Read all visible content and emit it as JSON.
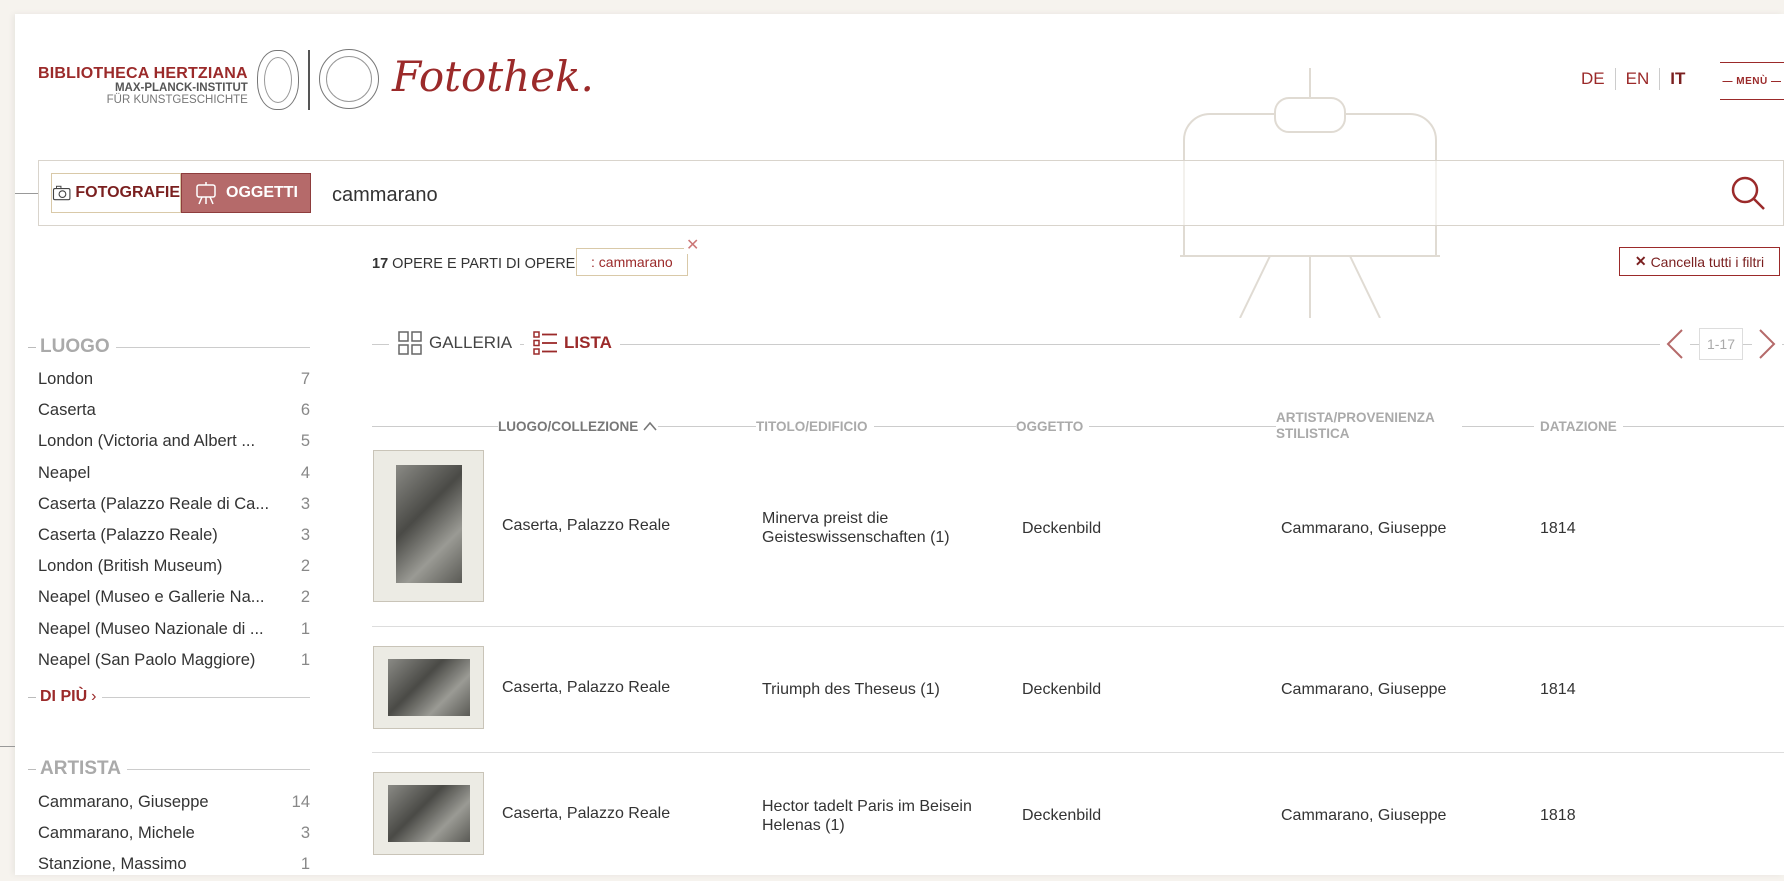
{
  "header": {
    "institute_line1": "BIBLIOTHECA HERTZIANA",
    "institute_line2": "MAX-PLANCK-INSTITUT",
    "institute_line3": "FÜR KUNSTGESCHICHTE",
    "site_title": "Fotothek.",
    "languages": [
      "DE",
      "EN",
      "IT"
    ],
    "active_language": "IT",
    "menu_label": "— MENÙ —"
  },
  "search": {
    "tab_photos": "FOTOGRAFIE",
    "tab_objects": "OGGETTI",
    "query": "cammarano"
  },
  "results": {
    "count": "17",
    "count_label": "OPERE E PARTI DI OPERE",
    "filter_chip": ": cammarano",
    "clear_all": "Cancella tutti i filtri",
    "view_gallery": "GALLERIA",
    "view_list": "LISTA",
    "page_range": "1-17"
  },
  "facets": {
    "luogo": {
      "title": "LUOGO",
      "items": [
        {
          "label": "London",
          "count": "7"
        },
        {
          "label": "Caserta",
          "count": "6"
        },
        {
          "label": "London (Victoria and Albert ...",
          "count": "5"
        },
        {
          "label": "Neapel",
          "count": "4"
        },
        {
          "label": "Caserta (Palazzo Reale di Ca...",
          "count": "3"
        },
        {
          "label": "Caserta (Palazzo Reale)",
          "count": "3"
        },
        {
          "label": "London (British Museum)",
          "count": "2"
        },
        {
          "label": "Neapel (Museo e Gallerie Na...",
          "count": "2"
        },
        {
          "label": "Neapel (Museo Nazionale di ...",
          "count": "1"
        },
        {
          "label": "Neapel (San Paolo Maggiore)",
          "count": "1"
        }
      ],
      "more": "DI PIÙ"
    },
    "artista": {
      "title": "ARTISTA",
      "items": [
        {
          "label": "Cammarano, Giuseppe",
          "count": "14"
        },
        {
          "label": "Cammarano, Michele",
          "count": "3"
        },
        {
          "label": "Stanzione, Massimo",
          "count": "1"
        }
      ]
    }
  },
  "table": {
    "columns": {
      "luogo": "LUOGO/COLLEZIONE",
      "titolo": "TITOLO/EDIFICIO",
      "oggetto": "OGGETTO",
      "artista": "ARTISTA/PROVENIENZA STILISTICA",
      "datazione": "DATAZIONE"
    },
    "rows": [
      {
        "luogo": "Caserta, Palazzo Reale",
        "titolo": "Minerva preist die Geisteswissenschaften (1)",
        "oggetto": "Deckenbild",
        "artista": "Cammarano, Giuseppe",
        "datazione": "1814"
      },
      {
        "luogo": "Caserta, Palazzo Reale",
        "titolo": "Triumph des Theseus (1)",
        "oggetto": "Deckenbild",
        "artista": "Cammarano, Giuseppe",
        "datazione": "1814"
      },
      {
        "luogo": "Caserta, Palazzo Reale",
        "titolo": "Hector tadelt Paris im Beisein Helenas (1)",
        "oggetto": "Deckenbild",
        "artista": "Cammarano, Giuseppe",
        "datazione": "1818"
      }
    ]
  },
  "colors": {
    "brand": "#9b2a2a",
    "active_tab": "#b56a6a"
  }
}
